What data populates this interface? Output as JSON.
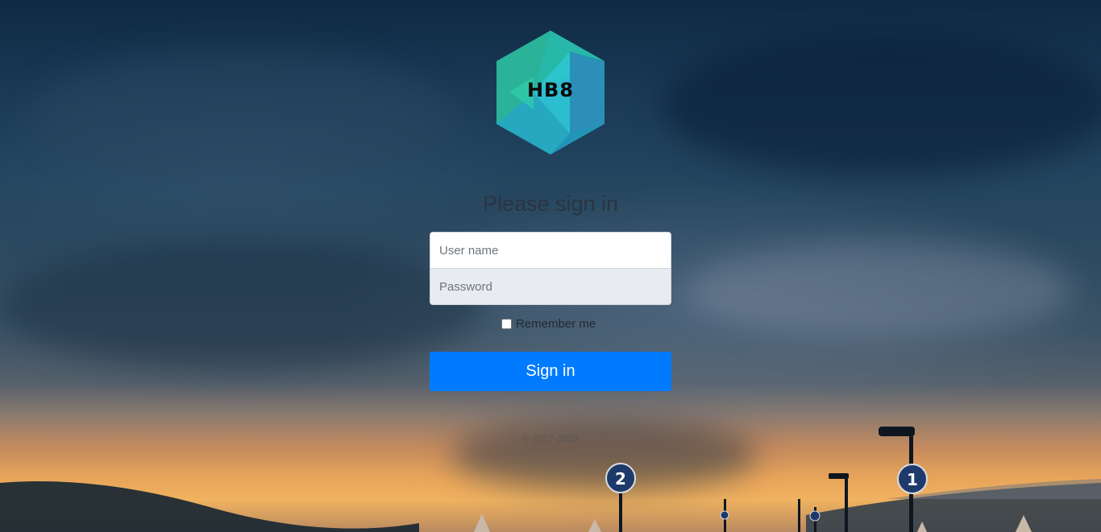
{
  "logo": {
    "text": "HB8",
    "colors": [
      "#2bb39a",
      "#27c6c6",
      "#2d9ec4",
      "#1f8fb5"
    ]
  },
  "form": {
    "heading": "Please sign in",
    "username_placeholder": "User name",
    "password_placeholder": "Password",
    "remember_label": "Remember me",
    "submit_label": "Sign in",
    "copyright": "© 2017-2023"
  },
  "colors": {
    "primary": "#007bff",
    "heading": "#2b3440"
  },
  "background": {
    "description_icons": [
      "street-lamp-icon",
      "sign-2-icon",
      "sign-1-icon"
    ]
  }
}
